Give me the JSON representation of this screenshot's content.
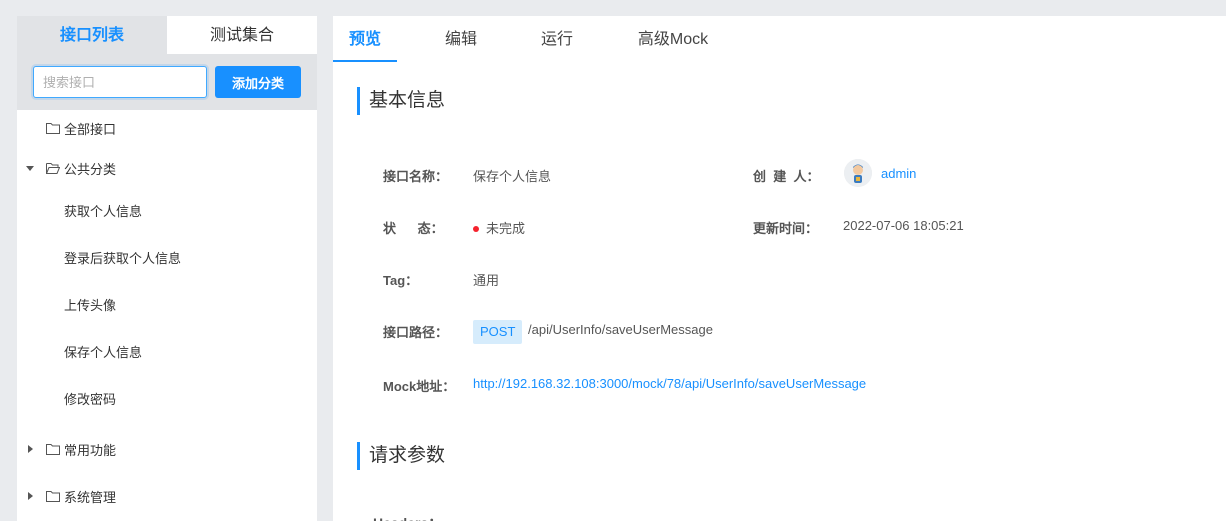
{
  "left_tabs": {
    "api_list": "接口列表",
    "test_collection": "测试集合"
  },
  "search": {
    "placeholder": "搜索接口",
    "add_category": "添加分类"
  },
  "tree": {
    "all": "全部接口",
    "public": "公共分类",
    "children": [
      "获取个人信息",
      "登录后获取个人信息",
      "上传头像",
      "保存个人信息",
      "修改密码"
    ],
    "common": "常用功能",
    "system": "系统管理"
  },
  "right_tabs": [
    "预览",
    "编辑",
    "运行",
    "高级Mock"
  ],
  "basic_info": {
    "title": "基本信息",
    "name_label": "接口名称：",
    "name_value": "保存个人信息",
    "creator_label": "创  建  人：",
    "creator_value": "admin",
    "status_label": "状      态：",
    "status_value": "未完成",
    "status_color": "#f5222d",
    "updated_label": "更新时间：",
    "updated_value": "2022-07-06 18:05:21",
    "tag_label": "Tag：",
    "tag_value": "通用",
    "path_label": "接口路径：",
    "method": "POST",
    "path_value": "/api/UserInfo/saveUserMessage",
    "mock_label": "Mock地址：",
    "mock_value": "http://192.168.32.108:3000/mock/78/api/UserInfo/saveUserMessage"
  },
  "request_params": {
    "title": "请求参数",
    "headers_label": "Headers："
  },
  "colors": {
    "accent": "#1890ff",
    "panel_gray": "#e1e3e6",
    "background": "#e9ebee"
  }
}
